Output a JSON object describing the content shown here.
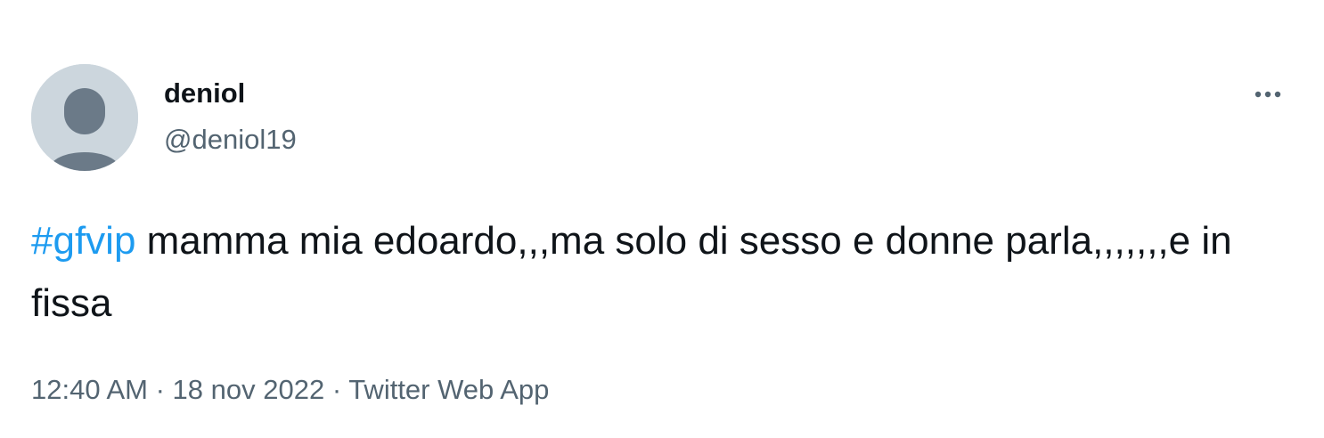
{
  "author": {
    "name": "deniol",
    "handle": "@deniol19",
    "avatar_icon": "default-profile-icon"
  },
  "more_icon": "more-options-icon",
  "tweet": {
    "hashtag": "#gfvip",
    "text": " mamma mia edoardo,,,ma solo di sesso e donne parla,,,,,,,e in fissa"
  },
  "meta": {
    "time": "12:40 AM",
    "separator1": " · ",
    "date": "18 nov 2022",
    "separator2": " · ",
    "source": "Twitter Web App"
  },
  "colors": {
    "hashtag": "#1d9bf0",
    "secondary_text": "#536471",
    "primary_text": "#0f1419",
    "avatar_bg": "#ccd6dd",
    "avatar_figure": "#6b7a88"
  }
}
